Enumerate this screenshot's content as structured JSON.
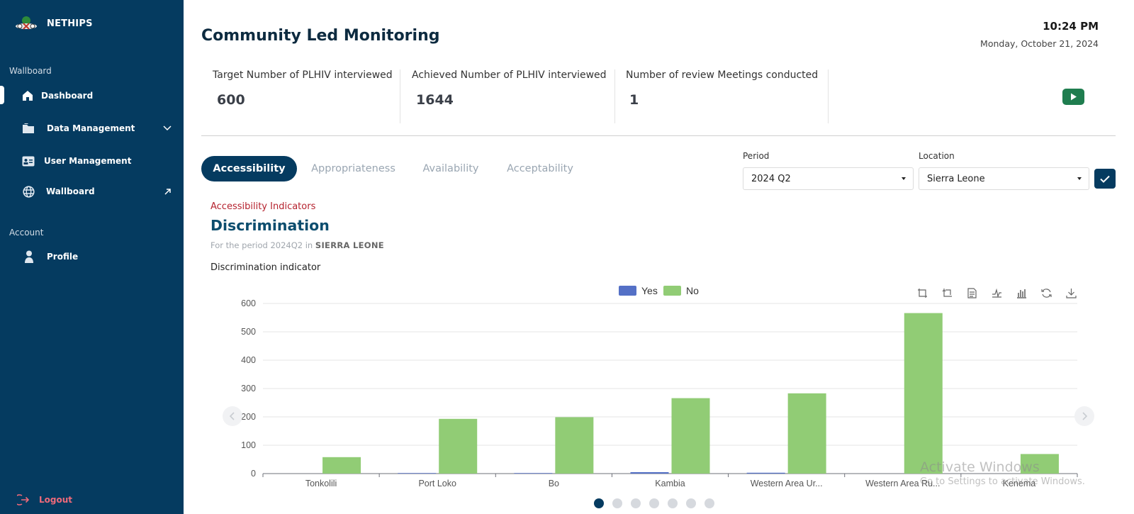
{
  "sidebar": {
    "brand": "NETHIPS",
    "section_wallboard": "Wallboard",
    "items": [
      {
        "label": "Dashboard",
        "icon": "home-icon",
        "active": true
      },
      {
        "label": "Data Management",
        "icon": "folder-icon",
        "trailing": "chevron-down-icon"
      },
      {
        "label": "User Management",
        "icon": "id-card-icon"
      },
      {
        "label": "Wallboard",
        "icon": "globe-icon",
        "trailing": "external-arrow-icon"
      }
    ],
    "section_account": "Account",
    "account_items": [
      {
        "label": "Profile",
        "icon": "user-icon"
      }
    ],
    "logout_label": "Logout"
  },
  "header": {
    "title": "Community Led Monitoring",
    "time": "10:24 PM",
    "date": "Monday, October 21, 2024"
  },
  "stats": [
    {
      "label": "Target Number of PLHIV interviewed",
      "value": "600"
    },
    {
      "label": "Achieved Number of PLHIV interviewed",
      "value": "1644"
    },
    {
      "label": "Number of review Meetings conducted",
      "value": "1"
    }
  ],
  "tabs": [
    {
      "label": "Accessibility",
      "active": true
    },
    {
      "label": "Appropriateness"
    },
    {
      "label": "Availability"
    },
    {
      "label": "Acceptability"
    }
  ],
  "filters": {
    "period_label": "Period",
    "period_value": "2024 Q2",
    "location_label": "Location",
    "location_value": "Sierra Leone"
  },
  "indicator": {
    "section_label": "Accessibility Indicators",
    "title": "Discrimination",
    "period_prefix": "For the period 2024Q2 in",
    "location": "SIERRA LEONE",
    "caption": "Discrimination indicator"
  },
  "colors": {
    "sidebar": "#053b60",
    "yes": "#5470c6",
    "no": "#91cc75",
    "play": "#1f7d4f",
    "logout": "#f06a7a"
  },
  "chart_data": {
    "type": "bar",
    "categories": [
      "Tonkolili",
      "Port Loko",
      "Bo",
      "Kambia",
      "Western Area Ur...",
      "Western Area Ru...",
      "Kenema"
    ],
    "series": [
      {
        "name": "Yes",
        "values": [
          0,
          2,
          2,
          5,
          3,
          0,
          0
        ]
      },
      {
        "name": "No",
        "values": [
          58,
          193,
          199,
          266,
          283,
          566,
          69
        ]
      }
    ],
    "ylim": [
      0,
      600
    ],
    "yticks": [
      0,
      100,
      200,
      300,
      400,
      500,
      600
    ],
    "legend": "top-center",
    "grid": true
  },
  "toolbox": [
    "zoom-icon",
    "zoom-reset-icon",
    "data-view-icon",
    "line-chart-icon",
    "bar-chart-icon",
    "restore-icon",
    "download-icon"
  ],
  "carousel": {
    "count": 7,
    "active": 0
  },
  "watermark": {
    "line1": "Activate Windows",
    "line2": "Go to Settings to activate Windows."
  }
}
